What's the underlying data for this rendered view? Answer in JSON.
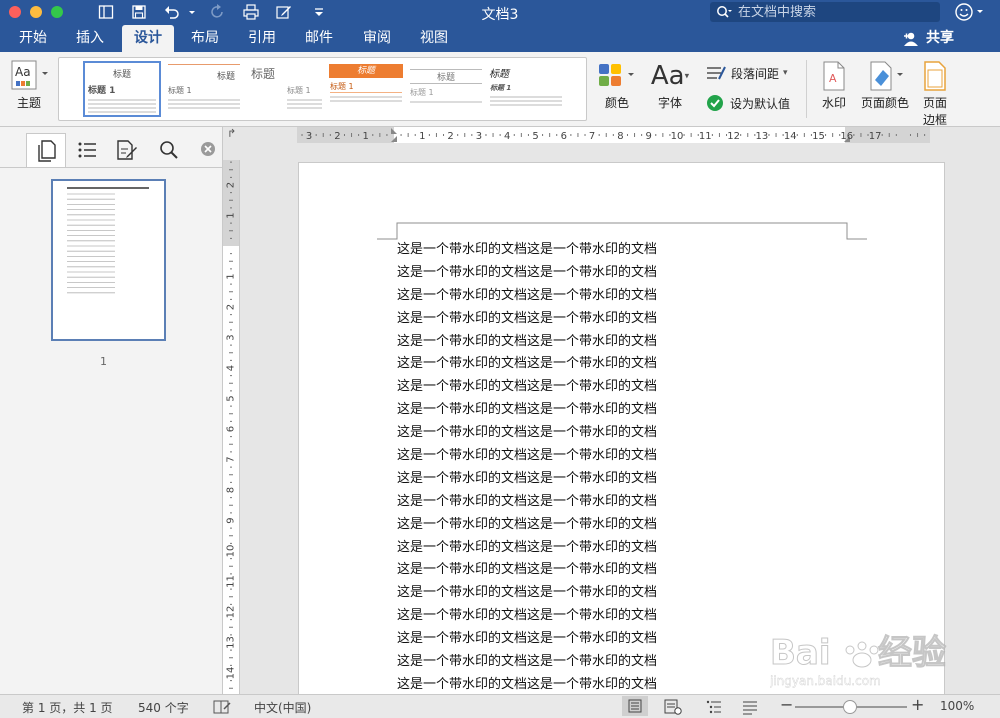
{
  "titlebar": {
    "title": "文档3",
    "search_placeholder": "在文档中搜索"
  },
  "tabs": [
    {
      "label": "开始"
    },
    {
      "label": "插入"
    },
    {
      "label": "设计"
    },
    {
      "label": "布局"
    },
    {
      "label": "引用"
    },
    {
      "label": "邮件"
    },
    {
      "label": "审阅"
    },
    {
      "label": "视图"
    }
  ],
  "active_tab": "设计",
  "share_label": "共享",
  "ribbon": {
    "theme": "主题",
    "colors": "颜色",
    "fonts": "字体",
    "paragraph_spacing": "段落间距",
    "set_default": "设为默认值",
    "watermark": "水印",
    "page_color": "页面颜色",
    "page_border_1": "页面",
    "page_border_2": "边框",
    "styles": [
      {
        "title": "标题",
        "heading": "标题 1"
      },
      {
        "title": "标题",
        "heading": "标题 1"
      },
      {
        "title": "标题",
        "heading": "标题 1"
      },
      {
        "title": "标题",
        "heading": "标题 1"
      },
      {
        "title": "标题",
        "heading": "标题 1"
      },
      {
        "title": "标题",
        "heading": "标题 1"
      }
    ]
  },
  "nav": {
    "page_number": "1"
  },
  "ruler_h": [
    "3",
    "2",
    "1",
    "1",
    "2",
    "3",
    "4",
    "5",
    "6",
    "7",
    "8",
    "9",
    "10",
    "11",
    "12",
    "13",
    "14",
    "15",
    "16",
    "17"
  ],
  "ruler_v": [
    "2",
    "1",
    "1",
    "2",
    "3",
    "4",
    "5",
    "6",
    "7",
    "8",
    "9",
    "10",
    "11",
    "12",
    "13",
    "14"
  ],
  "document": {
    "lines": [
      "这是一个带水印的文档这是一个带水印的文档",
      "这是一个带水印的文档这是一个带水印的文档",
      "这是一个带水印的文档这是一个带水印的文档",
      "这是一个带水印的文档这是一个带水印的文档",
      "这是一个带水印的文档这是一个带水印的文档",
      "这是一个带水印的文档这是一个带水印的文档",
      "这是一个带水印的文档这是一个带水印的文档",
      "这是一个带水印的文档这是一个带水印的文档",
      "这是一个带水印的文档这是一个带水印的文档",
      "这是一个带水印的文档这是一个带水印的文档",
      "这是一个带水印的文档这是一个带水印的文档",
      "这是一个带水印的文档这是一个带水印的文档",
      "这是一个带水印的文档这是一个带水印的文档",
      "这是一个带水印的文档这是一个带水印的文档",
      "这是一个带水印的文档这是一个带水印的文档",
      "这是一个带水印的文档这是一个带水印的文档",
      "这是一个带水印的文档这是一个带水印的文档",
      "这是一个带水印的文档这是一个带水印的文档",
      "这是一个带水印的文档这是一个带水印的文档",
      "这是一个带水印的文档这是一个带水印的文档"
    ]
  },
  "status": {
    "page_info": "第 1 页，共 1 页",
    "word_count": "540 个字",
    "language": "中文(中国)",
    "zoom": "100%"
  },
  "watermark": {
    "brand": "Baidu经验",
    "url": "jingyan.baidu.com"
  },
  "colors": {
    "accent": "#2b579a",
    "ribbon_bg": "#f3f3f3"
  }
}
